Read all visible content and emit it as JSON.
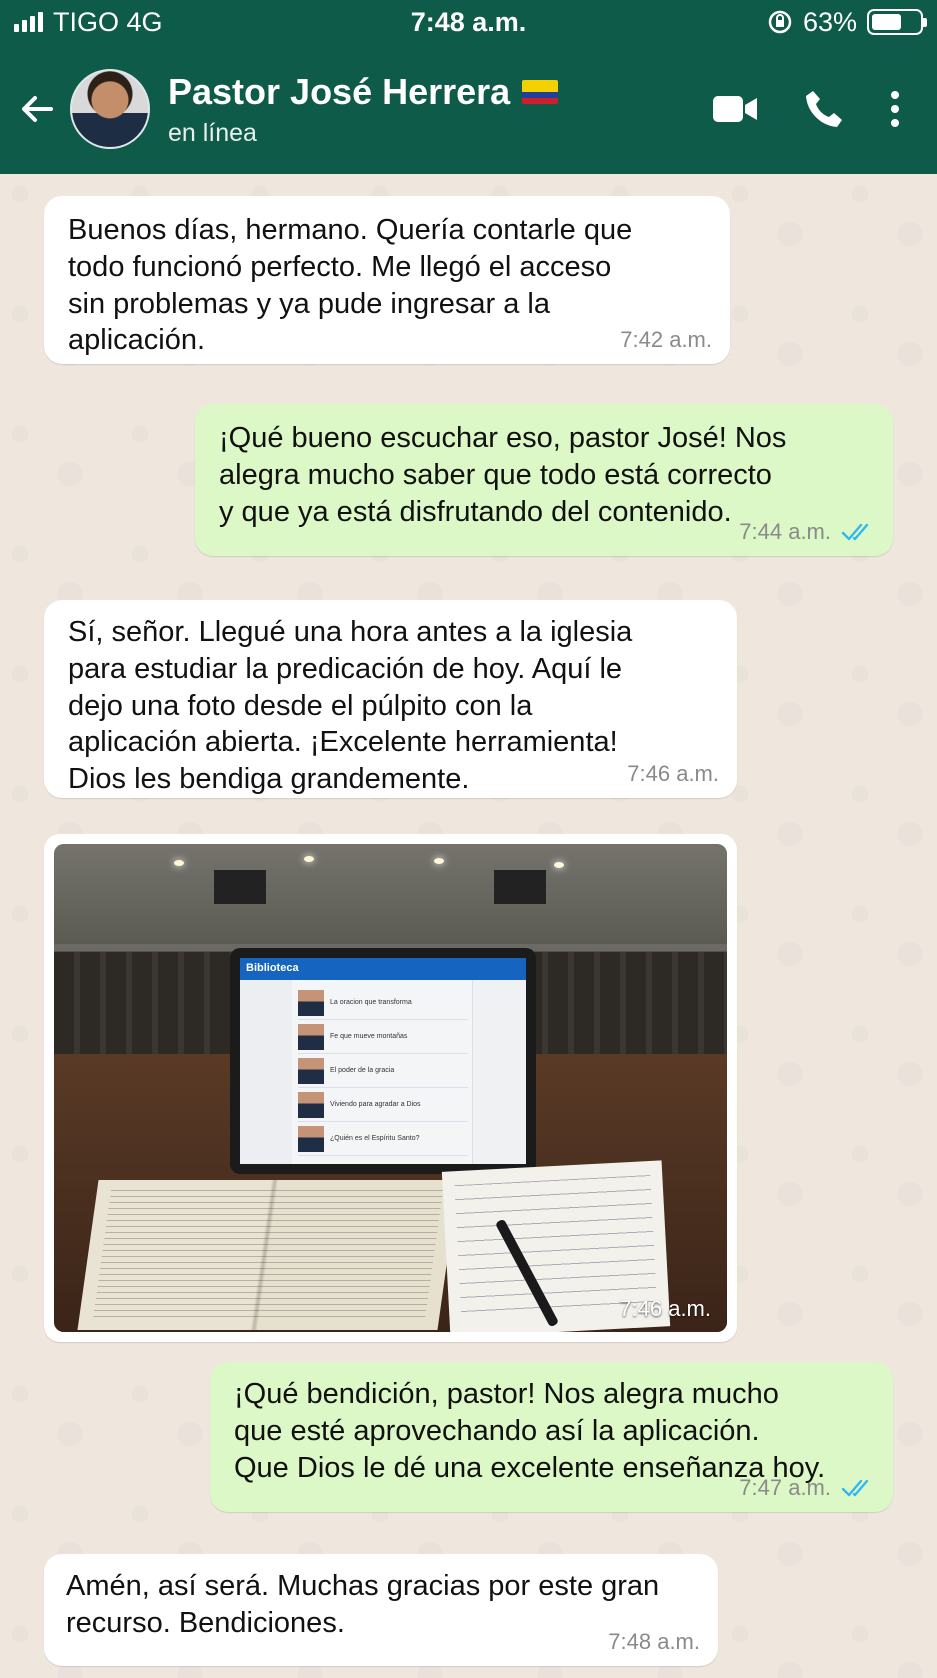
{
  "status_bar": {
    "carrier": "TIGO 4G",
    "time": "7:48 a.m.",
    "battery": "63%",
    "battery_level": 0.63
  },
  "header": {
    "contact_name": "Pastor José Herrera",
    "flag_icon": "colombia-flag-icon",
    "status": "en línea",
    "colors": {
      "header_bg": "#0f5b4a",
      "in_bubble": "#ffffff",
      "out_bubble": "#dcf8c6",
      "read_ticks": "#34b7f1"
    }
  },
  "messages": [
    {
      "direction": "in",
      "text": "Buenos días, hermano. Quería contarle que\ntodo funcionó perfecto. Me llegó el acceso\nsin problemas y ya pude ingresar a la\naplicación.",
      "time": "7:42 a.m."
    },
    {
      "direction": "out",
      "text": "¡Qué bueno escuchar eso, pastor José! Nos\nalegra mucho saber que todo está correcto\ny que ya está disfrutando del contenido.",
      "time": "7:44 a.m.",
      "status": "read"
    },
    {
      "direction": "in",
      "text": "Sí, señor. Llegué una hora antes a la iglesia\npara estudiar la predicación de hoy. Aquí le\ndejo una foto desde el púlpito con la\naplicación abierta. ¡Excelente herramienta!\nDios les bendiga grandemente.",
      "time": "7:46 a.m."
    },
    {
      "direction": "in",
      "type": "image",
      "time": "7:46 a.m.",
      "image": {
        "app_name": "Biblioteca",
        "items": [
          "La oracion que transforma",
          "Fe que mueve montañas",
          "El poder de la gracia",
          "Viviendo para agradar a Dios",
          "¿Quién es el Espíritu Santo?"
        ]
      }
    },
    {
      "direction": "out",
      "text": "¡Qué bendición, pastor! Nos alegra mucho\nque esté aprovechando así la aplicación.\nQue Dios le dé una excelente enseñanza hoy.",
      "time": "7:47 a.m.",
      "status": "read"
    },
    {
      "direction": "in",
      "text": "Amén, así será. Muchas gracias por este gran\nrecurso. Bendiciones.",
      "time": "7:48 a.m."
    }
  ]
}
